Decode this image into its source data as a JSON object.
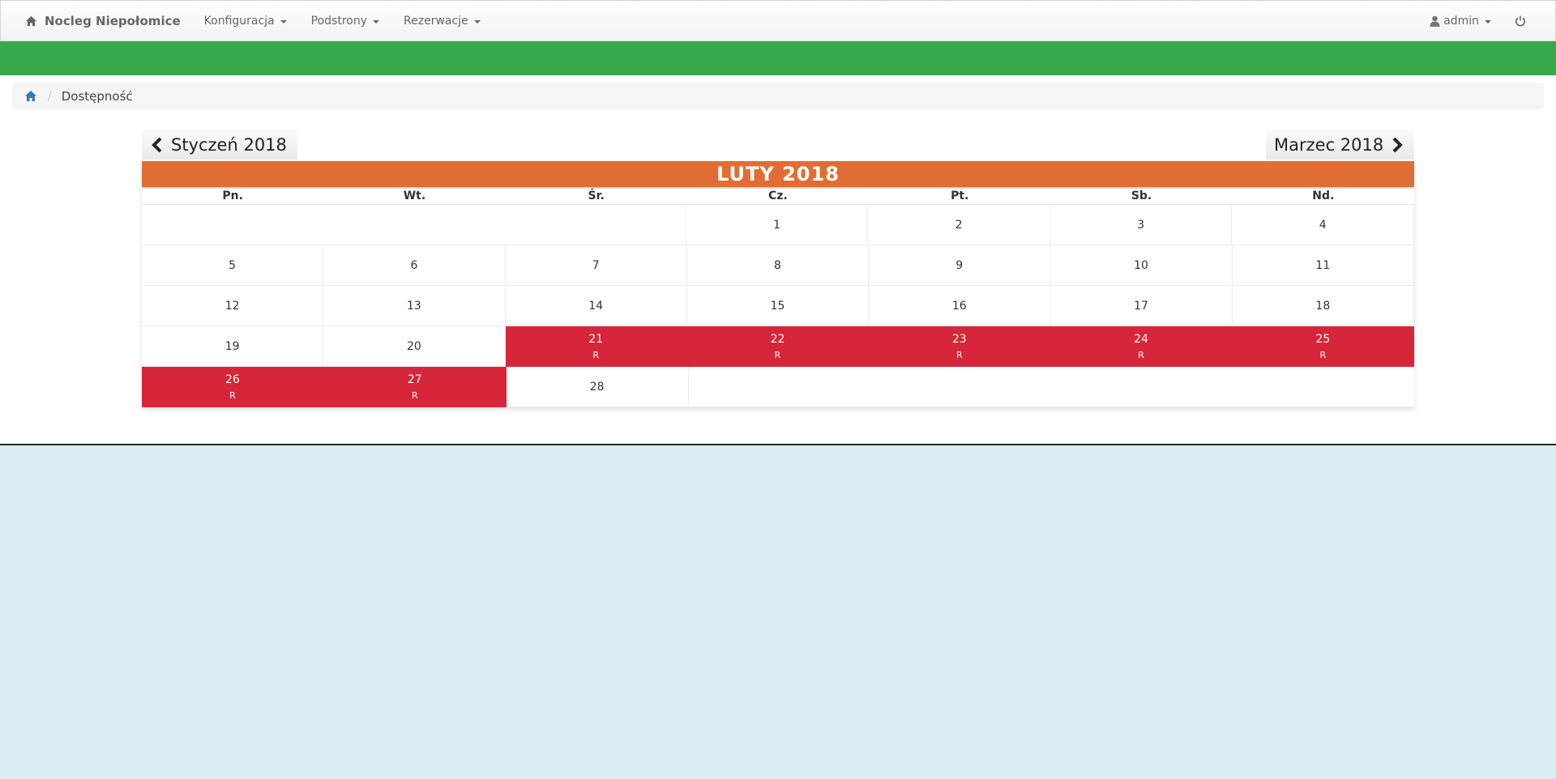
{
  "navbar": {
    "brand": "Nocleg Niepołomice",
    "menus": [
      {
        "label": "Konfiguracja"
      },
      {
        "label": "Podstrony"
      },
      {
        "label": "Rezerwacje"
      }
    ],
    "user": "admin"
  },
  "breadcrumb": {
    "current": "Dostępność"
  },
  "calendar": {
    "prev_month": "Styczeń 2018",
    "next_month": "Marzec 2018",
    "title": "LUTY 2018",
    "weekdays": [
      "Pn.",
      "Wt.",
      "Śr.",
      "Cz.",
      "Pt.",
      "Sb.",
      "Nd."
    ],
    "reserved_mark": "R",
    "days": {
      "d1": "1",
      "d2": "2",
      "d3": "3",
      "d4": "4",
      "d5": "5",
      "d6": "6",
      "d7": "7",
      "d8": "8",
      "d9": "9",
      "d10": "10",
      "d11": "11",
      "d12": "12",
      "d13": "13",
      "d14": "14",
      "d15": "15",
      "d16": "16",
      "d17": "17",
      "d18": "18",
      "d19": "19",
      "d20": "20",
      "d21": "21",
      "d22": "22",
      "d23": "23",
      "d24": "24",
      "d25": "25",
      "d26": "26",
      "d27": "27",
      "d28": "28"
    },
    "reserved_days": [
      "21",
      "22",
      "23",
      "24",
      "25",
      "26",
      "27"
    ]
  },
  "colors": {
    "green_band": "#38a94a",
    "month_header": "#e06d33",
    "reserved": "#d7263a",
    "bottom_area": "#daecf2"
  }
}
